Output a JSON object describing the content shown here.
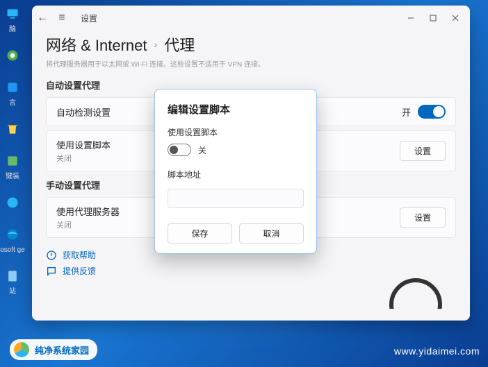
{
  "desktop": {
    "icons": [
      "脑",
      "",
      "言",
      "",
      "键装",
      "",
      "osoft ge",
      "",
      "站"
    ]
  },
  "window": {
    "back_icon": "←",
    "menu_icon": "≡",
    "title": "设置",
    "breadcrumb": {
      "root": "网络 & Internet",
      "current": "代理"
    },
    "subline": "将代理服务器用于以太网或 Wi-Fi 连接。这些设置不适用于 VPN 连接。",
    "sections": {
      "auto": {
        "label": "自动设置代理",
        "items": [
          {
            "title": "自动检测设置",
            "sub": "",
            "state_label": "开",
            "toggle_on": true
          },
          {
            "title": "使用设置脚本",
            "sub": "关闭",
            "action": "设置"
          }
        ]
      },
      "manual": {
        "label": "手动设置代理",
        "items": [
          {
            "title": "使用代理服务器",
            "sub": "关闭",
            "action": "设置"
          }
        ]
      }
    },
    "links": {
      "help": "获取帮助",
      "feedback": "提供反馈"
    }
  },
  "modal": {
    "title": "编辑设置脚本",
    "field_use_script": "使用设置脚本",
    "toggle_state": "关",
    "field_url": "脚本地址",
    "url_value": "",
    "save": "保存",
    "cancel": "取消"
  },
  "watermark": {
    "left_text": "纯净系统家园",
    "right_text": "www.yidaimei.com"
  }
}
